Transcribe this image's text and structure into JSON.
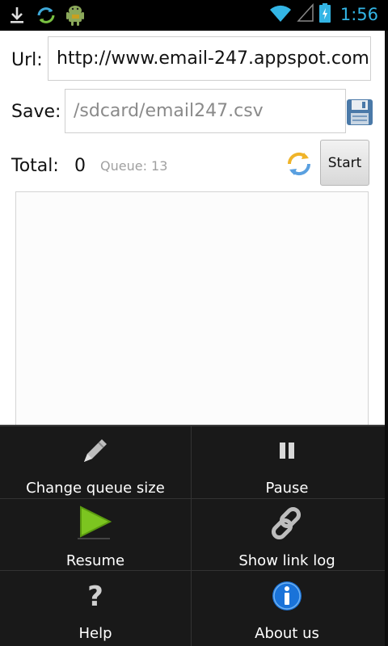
{
  "status_bar": {
    "time": "1:56",
    "icons": [
      "download-icon",
      "sync-icon",
      "android-icon",
      "wifi-icon",
      "signal-icon",
      "battery-icon"
    ]
  },
  "form": {
    "url_label": "Url:",
    "url_value": "http://www.email-247.appspot.com",
    "save_label": "Save:",
    "save_placeholder": "/sdcard/email247.csv",
    "total_label": "Total:",
    "total_value": "0",
    "queue_text": "Queue: 13",
    "start_label": "Start"
  },
  "menu": {
    "items": [
      {
        "label": "Change queue size",
        "icon": "pencil-icon"
      },
      {
        "label": "Pause",
        "icon": "pause-icon"
      },
      {
        "label": "Resume",
        "icon": "play-icon"
      },
      {
        "label": "Show link log",
        "icon": "chain-link-icon"
      },
      {
        "label": "Help",
        "icon": "question-icon"
      },
      {
        "label": "About us",
        "icon": "info-icon"
      }
    ]
  },
  "colors": {
    "accent": "#33b5e5",
    "menu_bg": "#191919",
    "resume_green": "#7cc520",
    "info_blue": "#1a73d9"
  }
}
